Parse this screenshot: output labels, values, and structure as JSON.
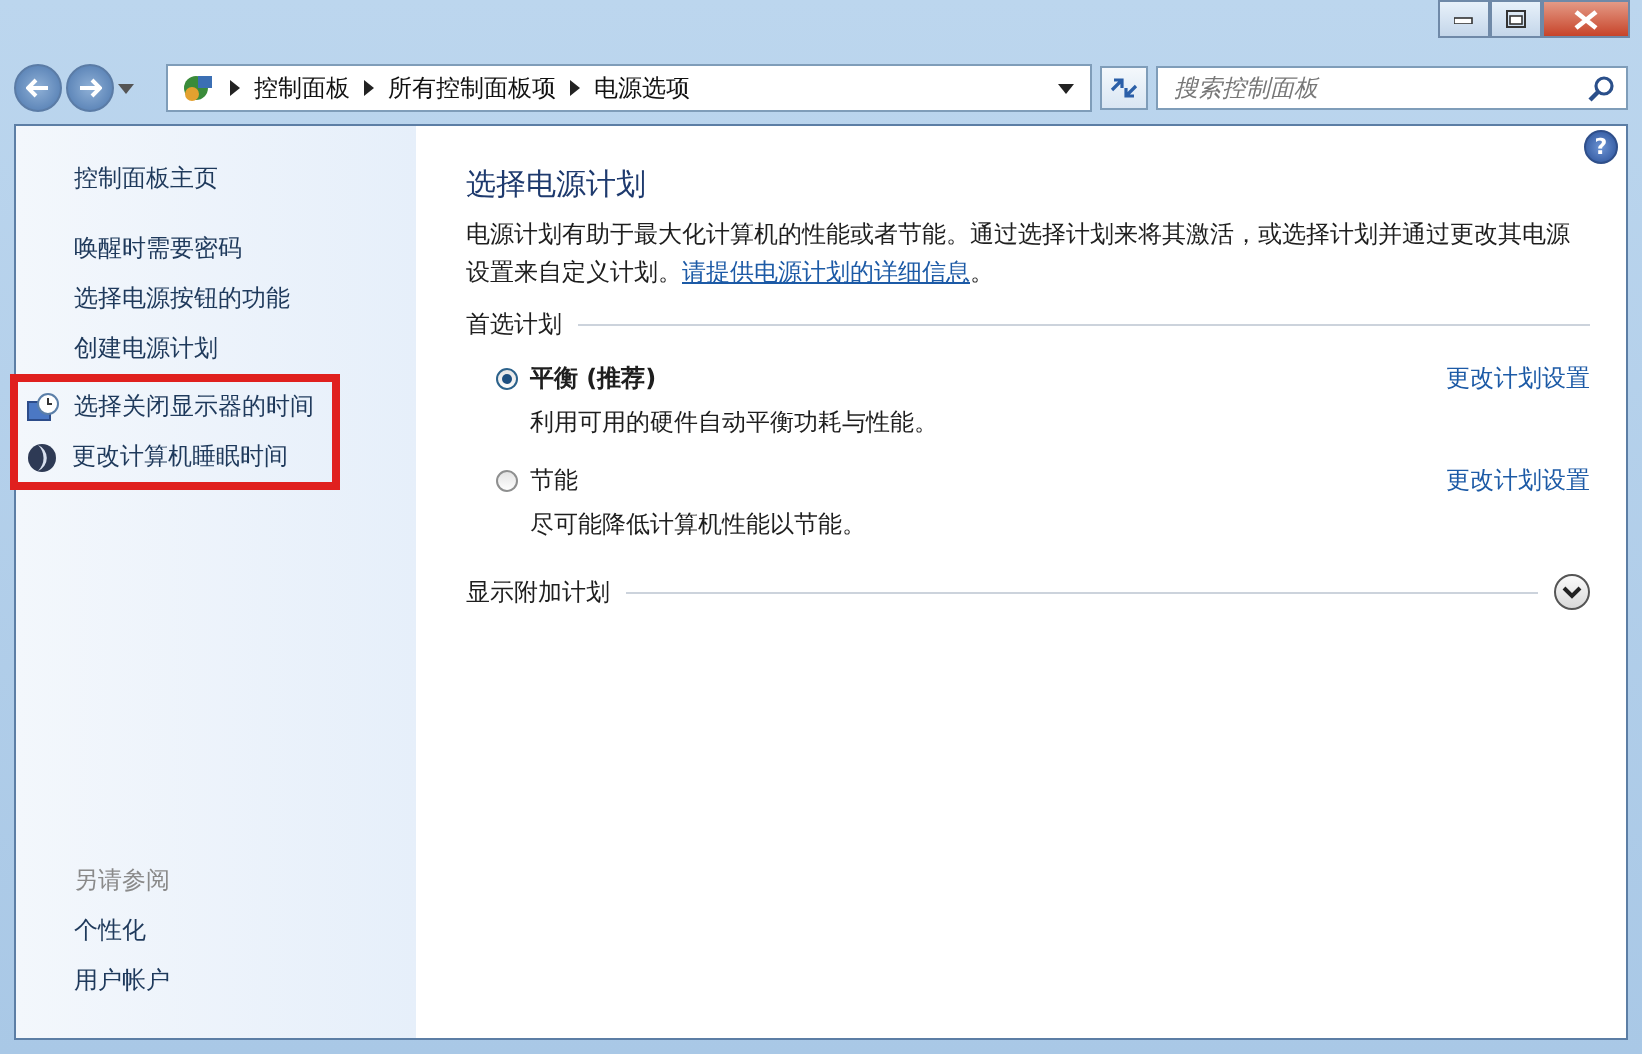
{
  "address_bar": {
    "breadcrumbs": [
      "控制面板",
      "所有控制面板项",
      "电源选项"
    ]
  },
  "search": {
    "placeholder": "搜索控制面板"
  },
  "sidebar": {
    "home": "控制面板主页",
    "tasks": [
      {
        "label": "唤醒时需要密码",
        "kind": "plain",
        "highlighted": false
      },
      {
        "label": "选择电源按钮的功能",
        "kind": "plain",
        "highlighted": false
      },
      {
        "label": "创建电源计划",
        "kind": "plain",
        "highlighted": false
      },
      {
        "label": "选择关闭显示器的时间",
        "kind": "display",
        "highlighted": true
      },
      {
        "label": "更改计算机睡眠时间",
        "kind": "sleep",
        "highlighted": true
      }
    ],
    "see_also": {
      "heading": "另请参阅",
      "links": [
        "个性化",
        "用户帐户"
      ]
    }
  },
  "main": {
    "help": "?",
    "title": "选择电源计划",
    "intro": "电源计划有助于最大化计算机的性能或者节能。通过选择计划来将其激活，或选择计划并通过更改其电源设置来自定义计划。",
    "intro_link": "请提供电源计划的详细信息",
    "intro_end": "。",
    "section": "首选计划",
    "plans": [
      {
        "name": "平衡 (推荐)",
        "selected": true,
        "description": "利用可用的硬件自动平衡功耗与性能。",
        "link": "更改计划设置"
      },
      {
        "name": "节能",
        "selected": false,
        "description": "尽可能降低计算机性能以节能。",
        "link": "更改计划设置"
      }
    ],
    "more": {
      "label": "显示附加计划",
      "expanded": false
    }
  }
}
